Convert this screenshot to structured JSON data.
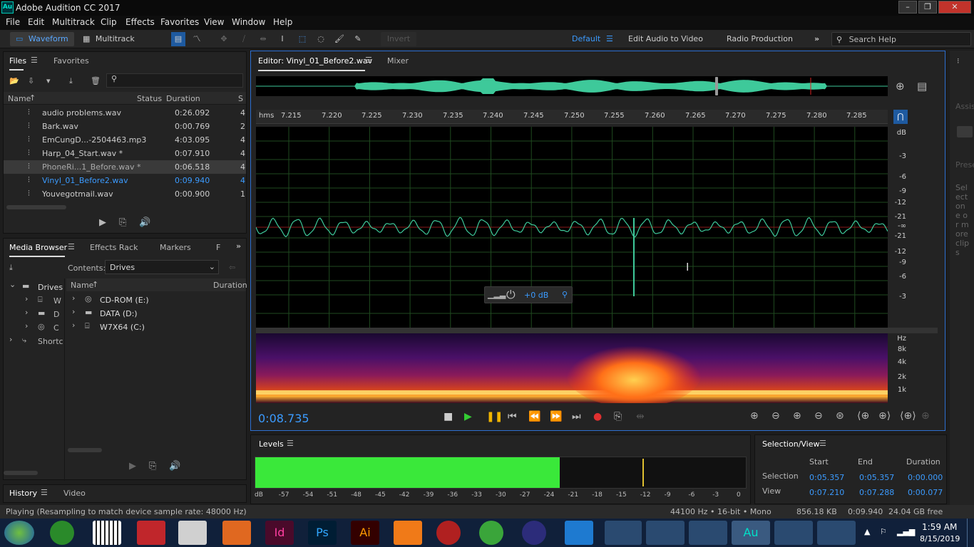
{
  "app": {
    "title": "Adobe Audition CC 2017",
    "logo": "Au"
  },
  "menu": [
    "File",
    "Edit",
    "Multitrack",
    "Clip",
    "Effects",
    "Favorites",
    "View",
    "Window",
    "Help"
  ],
  "toolbar": {
    "waveform": "Waveform",
    "multitrack": "Multitrack",
    "invert": "Invert",
    "workspace_default": "Default",
    "workspace_edit": "Edit Audio to Video",
    "workspace_radio": "Radio Production",
    "search_placeholder": "Search Help"
  },
  "files": {
    "tab_files": "Files",
    "tab_favorites": "Favorites",
    "col_name": "Name",
    "col_status": "Status",
    "col_duration": "Duration",
    "col_s": "S",
    "rows": [
      {
        "name": "audio problems.wav",
        "dur": "0:26.092",
        "s": "4"
      },
      {
        "name": "Bark.wav",
        "dur": "0:00.769",
        "s": "2"
      },
      {
        "name": "EmCungD...-2504463.mp3",
        "dur": "4:03.095",
        "s": "4"
      },
      {
        "name": "Harp_04_Start.wav *",
        "dur": "0:07.910",
        "s": "4"
      },
      {
        "name": "PhoneRi...1_Before.wav *",
        "dur": "0:06.518",
        "s": "4"
      },
      {
        "name": "Vinyl_01_Before2.wav",
        "dur": "0:09.940",
        "s": "4"
      },
      {
        "name": "Youvegotmail.wav",
        "dur": "0:00.900",
        "s": "1"
      }
    ]
  },
  "media": {
    "tab_media": "Media Browser",
    "tab_effects": "Effects Rack",
    "tab_markers": "Markers",
    "tab_f": "F",
    "contents_label": "Contents:",
    "contents_value": "Drives",
    "col_name": "Name",
    "col_duration": "Duration",
    "tree": [
      "Drives",
      "W",
      "D",
      "C",
      "Shortc"
    ],
    "drives": [
      "CD-ROM (E:)",
      "DATA (D:)",
      "W7X64 (C:)"
    ]
  },
  "history": {
    "tab_history": "History",
    "tab_video": "Video"
  },
  "editor": {
    "tab": "Editor: Vinyl_01_Before2.wav",
    "mixer": "Mixer",
    "ruler_unit": "hms",
    "ruler": [
      "7.215",
      "7.220",
      "7.225",
      "7.230",
      "7.235",
      "7.240",
      "7.245",
      "7.250",
      "7.255",
      "7.260",
      "7.265",
      "7.270",
      "7.275",
      "7.280",
      "7.285"
    ],
    "db_unit": "dB",
    "db_labels": [
      "-3",
      "-6",
      "-9",
      "-12",
      "-21",
      "-∞",
      "-21",
      "-12",
      "-9",
      "-6",
      "-3"
    ],
    "hz_unit": "Hz",
    "hz_labels": [
      "8k",
      "4k",
      "2k",
      "1k"
    ],
    "hud_value": "+0 dB",
    "time": "0:08.735"
  },
  "levels": {
    "title": "Levels",
    "fill_percent": 62,
    "scale": [
      "dB",
      "-57",
      "-54",
      "-51",
      "-48",
      "-45",
      "-42",
      "-39",
      "-36",
      "-33",
      "-30",
      "-27",
      "-24",
      "-21",
      "-18",
      "-15",
      "-12",
      "-9",
      "-6",
      "-3",
      "0"
    ]
  },
  "selection": {
    "title": "Selection/View",
    "col_start": "Start",
    "col_end": "End",
    "col_duration": "Duration",
    "row_selection": "Selection",
    "row_view": "View",
    "sel_start": "0:05.357",
    "sel_end": "0:05.357",
    "sel_dur": "0:00.000",
    "view_start": "0:07.210",
    "view_end": "0:07.288",
    "view_dur": "0:00.077"
  },
  "status": {
    "playing": "Playing (Resampling to match device sample rate: 48000 Hz)",
    "format": "44100 Hz • 16-bit • Mono",
    "size": "856.18 KB",
    "duration": "0:09.940",
    "free": "24.04 GB free"
  },
  "right_panel": {
    "assist": "Assis",
    "preset": "Prese",
    "hint": "Select one or more clips"
  },
  "taskbar": {
    "time": "1:59 AM",
    "date": "8/15/2019",
    "id_label": "Id",
    "ps_label": "Ps",
    "ai_label": "Ai",
    "au_label": "Au"
  },
  "colors": {
    "accent": "#2d8ceb",
    "waveform": "#3ec99a",
    "levels_green": "#3ae83a"
  }
}
